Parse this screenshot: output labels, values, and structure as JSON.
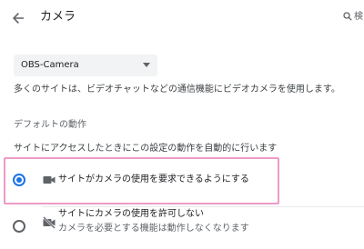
{
  "header": {
    "title": "カメラ",
    "search_partial": "検",
    "back_icon": "arrow-left-icon",
    "search_icon": "search-icon"
  },
  "device_select": {
    "value": "OBS-Camera"
  },
  "description": "多くのサイトは、ビデオチャットなどの通信機能にビデオカメラを使用します。",
  "default_behavior": {
    "heading": "デフォルトの動作",
    "subtitle": "サイトにアクセスしたときにこの設定の動作を自動的に行います",
    "options": [
      {
        "label": "サイトがカメラの使用を要求できるようにする",
        "sublabel": "",
        "selected": true,
        "icon": "videocam-icon"
      },
      {
        "label": "サイトにカメラの使用を許可しない",
        "sublabel": "カメラを必要とする機能は動作しなくなります",
        "selected": false,
        "icon": "videocam-off-icon"
      }
    ]
  },
  "colors": {
    "accent": "#1a73e8",
    "highlight_border": "#ee9bc7",
    "select_bg": "#f1f3f4"
  }
}
